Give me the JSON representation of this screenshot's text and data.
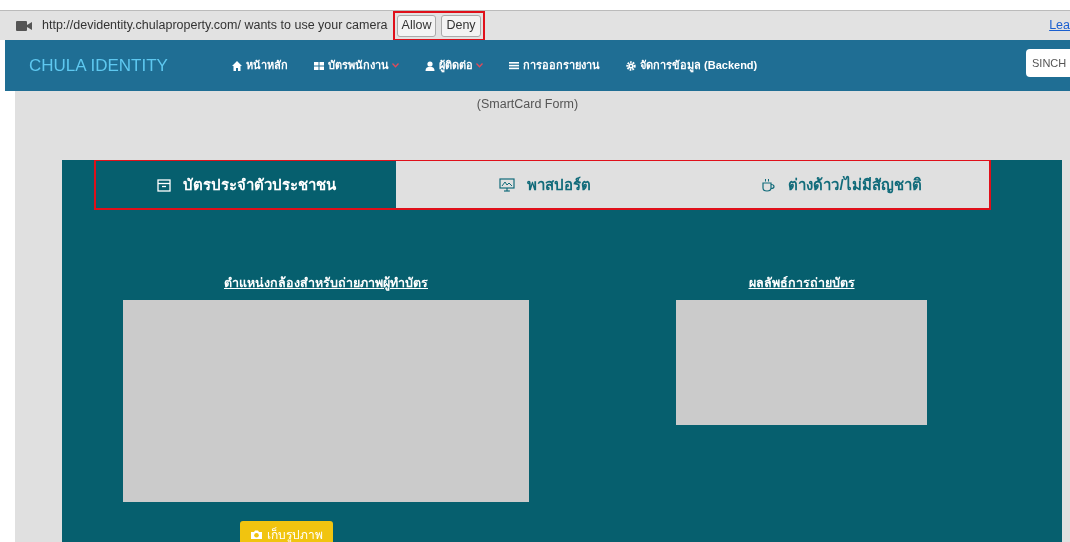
{
  "permission_bar": {
    "message": "http://devidentity.chulaproperty.com/ wants to use your camera",
    "buttons": [
      "Allow",
      "Deny"
    ],
    "link": "Lea"
  },
  "navbar": {
    "brand": "CHULA IDENTITY",
    "items": [
      {
        "label": "หน้าหลัก",
        "dropdown": false
      },
      {
        "label": "บัตรพนักงาน",
        "dropdown": true
      },
      {
        "label": "ผู้ติดต่อ",
        "dropdown": true
      },
      {
        "label": "การออกรายงาน",
        "dropdown": false
      },
      {
        "label": "จัดการข้อมูล (Backend)",
        "dropdown": false
      }
    ],
    "search": {
      "value": "SINCH"
    }
  },
  "form_subtitle": "(SmartCard Form)",
  "tabs": [
    {
      "label": "บัตรประจำตัวประชาชน",
      "selected": true
    },
    {
      "label": "พาสปอร์ต",
      "selected": false
    },
    {
      "label": "ต่างด้าว/ไม่มีสัญชาติ",
      "selected": false
    }
  ],
  "camera_panel": {
    "title": "ตำแหน่งกล้องสำหรับถ่ายภาพผู้ทำบัตร",
    "button": "เก็บรูปภาพ"
  },
  "result_panel": {
    "title": "ผลลัพธ์การถ่ายบัตร"
  }
}
